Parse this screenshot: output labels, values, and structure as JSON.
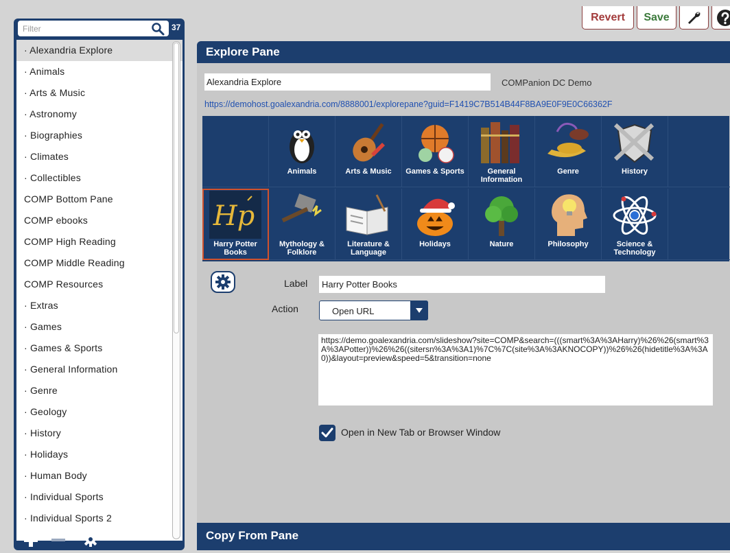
{
  "sidebar": {
    "filter_placeholder": "Filter",
    "count": "37",
    "items": [
      {
        "label": "· Alexandria Explore",
        "active": true
      },
      {
        "label": "· Animals"
      },
      {
        "label": "· Arts & Music"
      },
      {
        "label": "· Astronomy"
      },
      {
        "label": "· Biographies"
      },
      {
        "label": "· Climates"
      },
      {
        "label": "· Collectibles"
      },
      {
        "label": "COMP Bottom Pane"
      },
      {
        "label": "COMP ebooks"
      },
      {
        "label": "COMP High Reading"
      },
      {
        "label": "COMP Middle Reading"
      },
      {
        "label": "COMP Resources"
      },
      {
        "label": "· Extras"
      },
      {
        "label": "· Games"
      },
      {
        "label": "· Games & Sports"
      },
      {
        "label": "· General Information"
      },
      {
        "label": "· Genre"
      },
      {
        "label": "· Geology"
      },
      {
        "label": "· History"
      },
      {
        "label": "· Holidays"
      },
      {
        "label": "· Human Body"
      },
      {
        "label": "· Individual Sports"
      },
      {
        "label": "· Individual Sports 2"
      }
    ],
    "footer": {
      "add_icon": "plus-icon",
      "remove_icon": "minus-icon",
      "settings_icon": "gear-icon"
    }
  },
  "toolbar": {
    "revert_label": "Revert",
    "save_label": "Save",
    "tools_icon": "wrench-icon",
    "help_icon": "help-icon"
  },
  "explore_pane": {
    "title": "Explore Pane",
    "name_value": "Alexandria Explore",
    "org_name": "COMPanion DC Demo",
    "url": "https://demohost.goalexandria.com/8888001/explorepane?guid=F1419C7B514B44F8BA9E0F9E0C66362F",
    "tiles": [
      {
        "label": "",
        "icon": "empty"
      },
      {
        "label": "Animals",
        "icon": "penguin"
      },
      {
        "label": "Arts & Music",
        "icon": "guitar"
      },
      {
        "label": "Games & Sports",
        "icon": "balls"
      },
      {
        "label": "General Information",
        "icon": "books"
      },
      {
        "label": "Genre",
        "icon": "lamp"
      },
      {
        "label": "History",
        "icon": "shield-swords"
      },
      {
        "label": "",
        "icon": "empty"
      },
      {
        "label": "Harry Potter Books",
        "icon": "hp-logo",
        "selected": true
      },
      {
        "label": "Mythology & Folklore",
        "icon": "hammer"
      },
      {
        "label": "Literature & Language",
        "icon": "open-book"
      },
      {
        "label": "Holidays",
        "icon": "pumpkin"
      },
      {
        "label": "Nature",
        "icon": "tree"
      },
      {
        "label": "Philosophy",
        "icon": "head-bulb"
      },
      {
        "label": "Science & Technology",
        "icon": "atom"
      },
      {
        "label": "",
        "icon": "empty"
      }
    ],
    "tile_settings_icon": "gear-icon",
    "label_caption": "Label",
    "label_value": "Harry Potter Books",
    "action_caption": "Action",
    "action_value": "Open URL",
    "action_url": "https://demo.goalexandria.com/slideshow?site=COMP&search=(((smart%3A%3AHarry)%26%26(smart%3A%3APotter))%26%26((sitersn%3A%3A1)%7C%7C(site%3A%3AKNOCOPY))%26%26(hidetitle%3A%3A0))&layout=preview&speed=5&transition=none",
    "new_tab_checked": true,
    "new_tab_label": "Open in New Tab or Browser Window"
  },
  "copy_pane": {
    "title": "Copy From Pane"
  },
  "colors": {
    "navy": "#1c3e6e",
    "revert": "#a33b3b",
    "save": "#3b7a3b",
    "link": "#2050b0",
    "selected_outline": "#d2522c"
  }
}
